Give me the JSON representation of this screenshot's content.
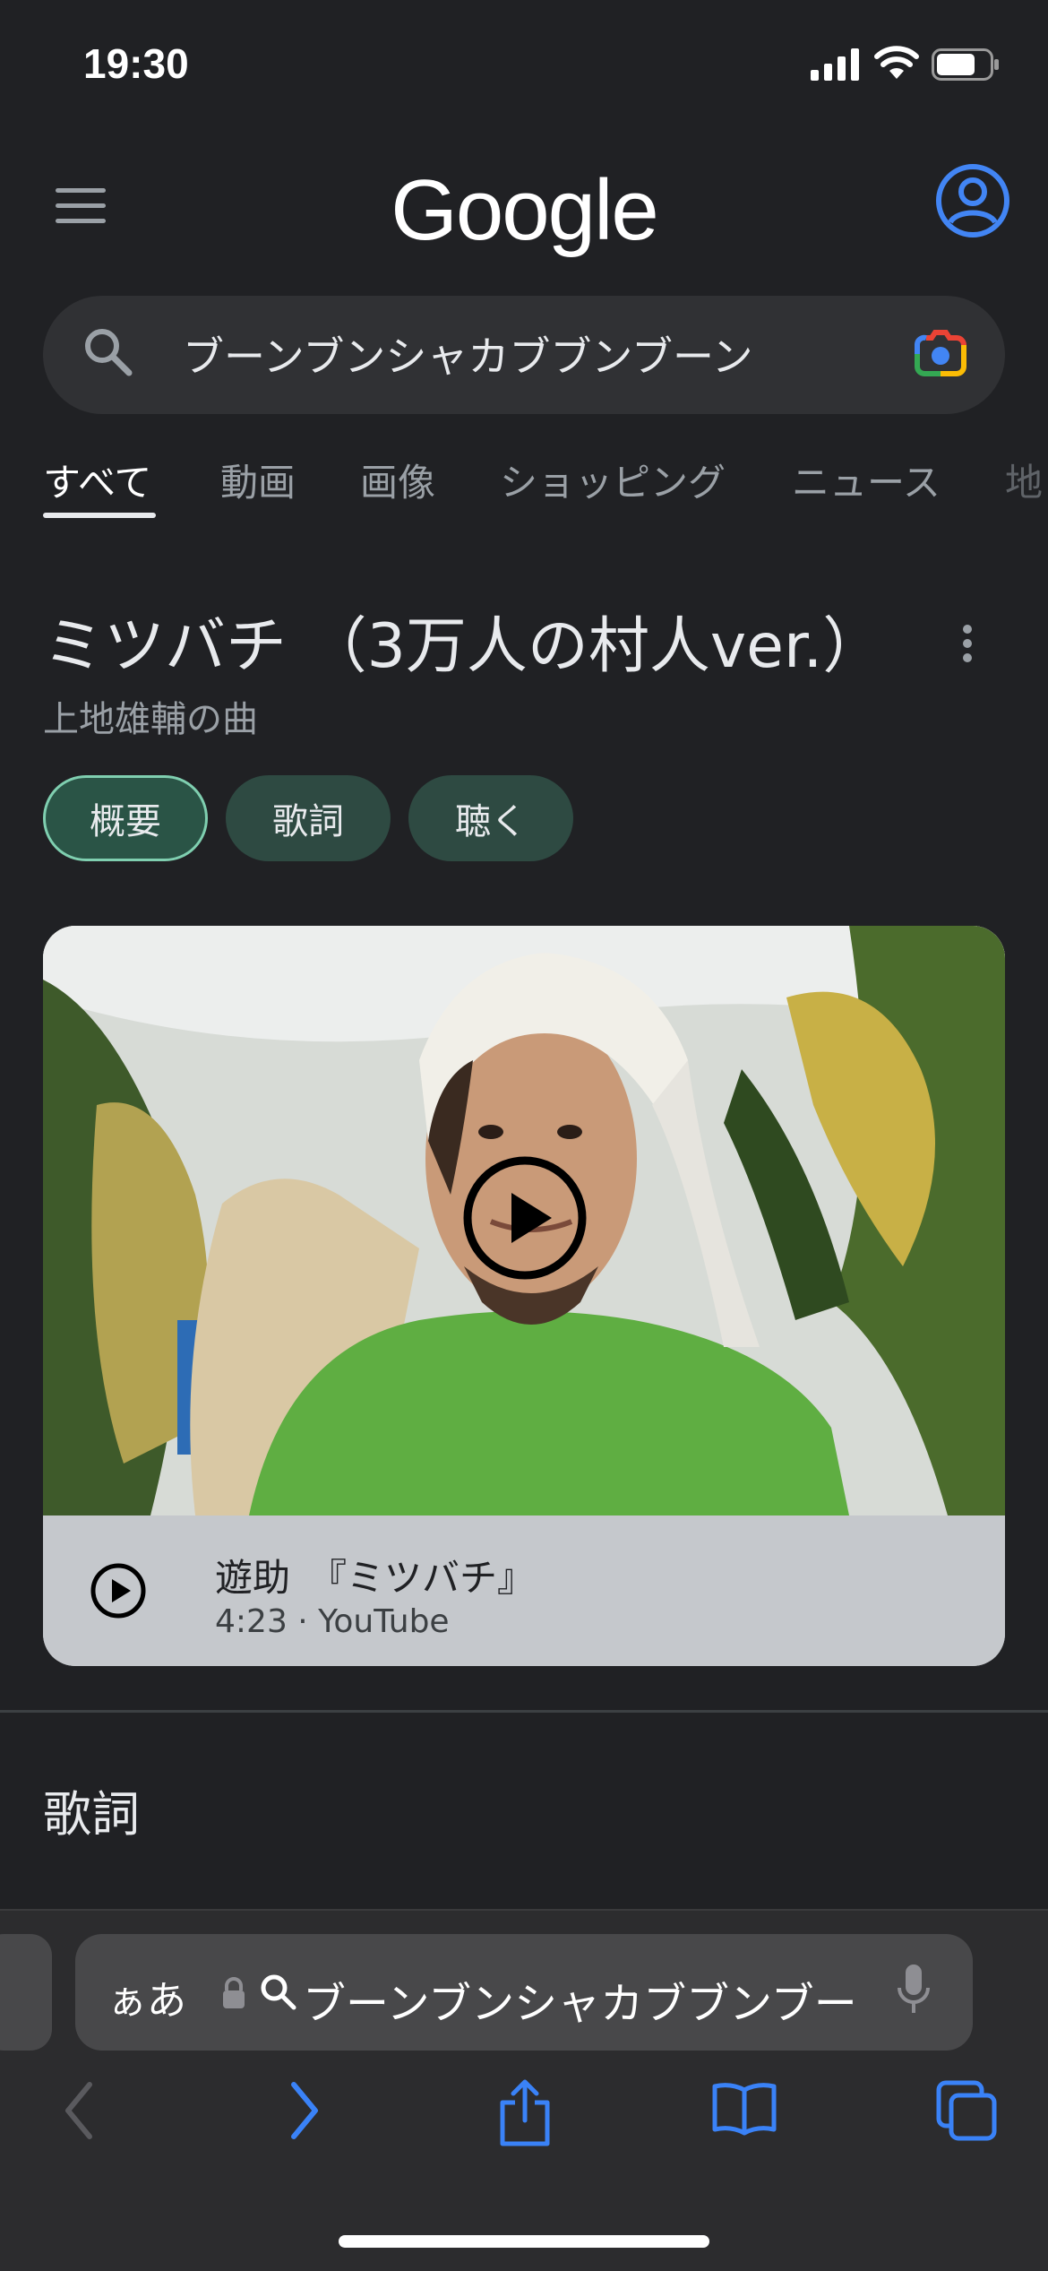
{
  "status_bar": {
    "time": "19:30"
  },
  "header": {
    "logo": "Google"
  },
  "search": {
    "query": "ブーンブンシャカブブンブーン"
  },
  "tabs": [
    "すべて",
    "動画",
    "画像",
    "ショッピング",
    "ニュース",
    "地"
  ],
  "knowledge_panel": {
    "title": "ミツバチ （3万人の村人ver.）",
    "subtitle": "上地雄輔の曲",
    "chips": [
      "概要",
      "歌詞",
      "聴く"
    ]
  },
  "video": {
    "title": "遊助　『ミツバチ』",
    "meta": "4:23 · YouTube"
  },
  "lyrics_heading": "歌詞",
  "safari": {
    "aa_label": "ぁあ",
    "address_text": "ブーンブンシャカブブンブーン"
  },
  "colors": {
    "background": "#202124",
    "accent_blue": "#4285f4",
    "chip": "#2e4a42",
    "safari_blue": "#3a82f7"
  }
}
